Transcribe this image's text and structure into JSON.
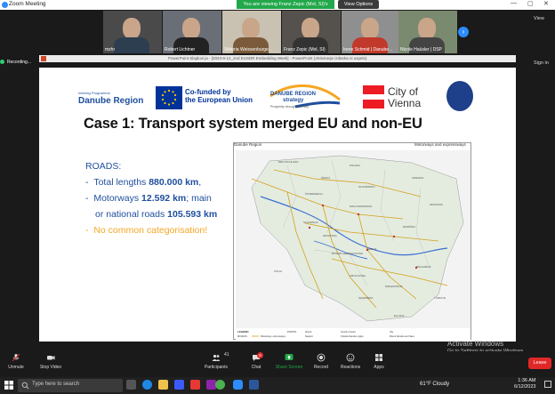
{
  "window": {
    "title": "Zoom Meeting",
    "view_label": "View",
    "sign_in_label": "Sign in"
  },
  "banner": {
    "sharing_text": "You are viewing Franz Zepic (Mol, SI)'s screen",
    "view_options": "View Options"
  },
  "gallery": {
    "participants": [
      {
        "name": "mzhr"
      },
      {
        "name": "Robert Lichtner"
      },
      {
        "name": "Viktoria Weissenburge..."
      },
      {
        "name": "Franz Zepic (Mol, SI)"
      },
      {
        "name": "Irene Schmid | Danube..."
      },
      {
        "name": "Nicole Haüsler | DSP"
      }
    ]
  },
  "recording": {
    "label": "Recording..."
  },
  "ppt": {
    "title": "PowerPoint Slajdovi ja - [2023-6-12_2nd EUSDR Embedding Week] - PowerPoint (Aktiviranje izdanka ni uspelo)"
  },
  "slide": {
    "logos": {
      "interreg_small": "Interreg Programme",
      "interreg_name": "Danube Region",
      "eu_line1": "Co-funded by",
      "eu_line2": "the European Union",
      "drs_line1": "DANUBE REGION",
      "drs_line2": "strategy",
      "drs_line3": "Prosperity through Diversity",
      "vienna_line1": "City of",
      "vienna_line2": "Vienna"
    },
    "title": "Case 1: Transport system merged EU and non-EU",
    "roads_heading": "ROADS:",
    "bullets": [
      {
        "dash": "-",
        "text": "Total lengths ",
        "bold": "880.000 km",
        "tail": ","
      },
      {
        "dash": "-",
        "text": "Motorways ",
        "bold": "12.592 km",
        "tail": "; main"
      },
      {
        "dash": "",
        "text": "or national roads ",
        "bold": "105.593 km",
        "tail": ""
      },
      {
        "dash": "-",
        "text": "No common categorisation!",
        "bold": "",
        "tail": ""
      }
    ],
    "map": {
      "title_left": "Danube Region",
      "title_right": "Motorways and expressways",
      "legend_heading": "LEGEND",
      "legend_roads": "ROADS",
      "legend_ports": "PORTS",
      "legend_items": [
        "Motorways, expressways",
        "Airport",
        "Seaport",
        "Country border",
        "Outside Danube region",
        "City",
        "Rivers Danube and Sava"
      ],
      "countries": [
        "DEUTSCHLAND",
        "POLSKA",
        "ČESKÁ",
        "SLOVENSKO",
        "UKRAINA",
        "ÖSTERREICH",
        "MAGYARORSZÁG",
        "MOLDOVA",
        "ROMÂNIA",
        "SLOVENIJA",
        "HRVATSKA",
        "BOSNA I HERCEGOVINA",
        "SRBIJA",
        "BĂLGARIJA",
        "ITALIA",
        "CRNA GORA",
        "SHQIPËRIA",
        "MAKEDONIJA",
        "TÜRKIYE",
        "ELLADA"
      ]
    }
  },
  "watermark": {
    "line1": "Activate Windows",
    "line2": "Go to Settings to activate Windows."
  },
  "toolbar": {
    "unmute": "Unmute",
    "stop_video": "Stop Video",
    "participants": "Participants",
    "participants_count": "41",
    "chat": "Chat",
    "chat_badge": "8",
    "share": "Share Screen",
    "record": "Record",
    "reactions": "Reactions",
    "apps": "Apps",
    "leave": "Leave"
  },
  "taskbar": {
    "search_placeholder": "Type here to search",
    "weather": "61°F  Cloudy",
    "time": "1:36 AM",
    "date": "6/12/2023"
  },
  "colors": {
    "accent": "#2d8cff",
    "share_green": "#22a84a",
    "leave_red": "#e02828",
    "slide_blue": "#1f4e9e",
    "warning_orange": "#f5a623"
  }
}
